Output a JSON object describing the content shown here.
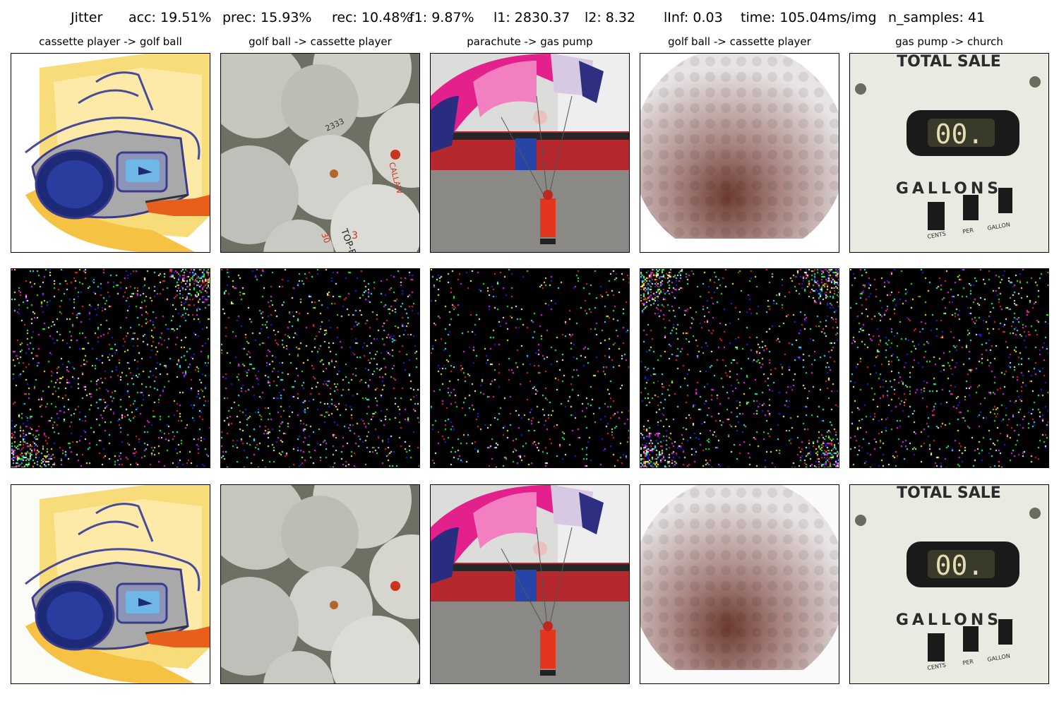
{
  "figure": {
    "suptitle": {
      "method": "Jitter",
      "acc": "acc: 19.51%",
      "prec": "prec: 15.93%",
      "rec": "rec: 10.48%",
      "f1": "f1: 9.87%",
      "l1": "l1: 2830.37",
      "l2": "l2: 8.32",
      "linf": "lInf: 0.03",
      "time": "time: 105.04ms/img",
      "n_samples": "n_samples: 41"
    },
    "columns": [
      {
        "title": "cassette player -> golf ball",
        "subject": "cassette player"
      },
      {
        "title": "golf ball -> cassette player",
        "subject": "golf balls"
      },
      {
        "title": "parachute -> gas pump",
        "subject": "parachute"
      },
      {
        "title": "golf ball -> cassette player",
        "subject": "golf ball"
      },
      {
        "title": "gas pump -> church",
        "subject": "gas pump"
      }
    ],
    "rows": [
      "original",
      "perturbation",
      "adversarial"
    ],
    "gas_pump_text": {
      "total_sale": "TOTAL SALE",
      "gallons": "GALLONS",
      "digits": "00.",
      "small_labels": [
        "CENTS",
        "PER",
        "GALLON"
      ]
    },
    "golf_ball_print": [
      "CALLAW",
      "TOP-FLITE",
      "3",
      "30"
    ]
  }
}
